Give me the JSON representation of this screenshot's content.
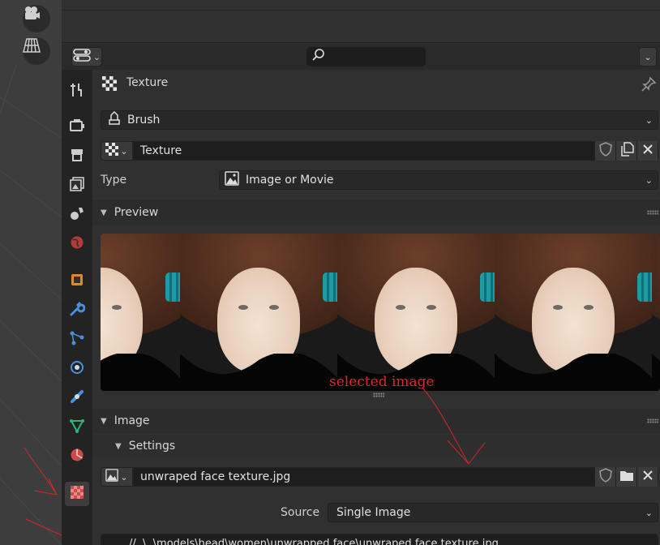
{
  "panel": {
    "title": "Texture",
    "search_placeholder": ""
  },
  "texture_slot": {
    "brush_label": "Brush",
    "texture_name": "Texture",
    "type_label": "Type",
    "type_value": "Image or Movie"
  },
  "preview": {
    "section_title": "Preview"
  },
  "image": {
    "section_title": "Image",
    "settings_title": "Settings",
    "image_name": "unwraped face texture.jpg",
    "source_label": "Source",
    "source_value": "Single Image",
    "filepath": "//..\\..\\models\\head\\women\\unwrapped face\\unwraped face texture.jpg"
  },
  "annotation": {
    "text": "selected image",
    "color": "#e0262a"
  },
  "tabs": [
    "tool-tab",
    "render-tab",
    "output-tab",
    "view-layer-tab",
    "scene-tab",
    "world-tab",
    "object-tab",
    "modifier-tab",
    "particles-tab",
    "physics-tab",
    "constraints-tab",
    "data-tab",
    "material-tab",
    "texture-tab"
  ],
  "colors": {
    "editor_bg": "#303030",
    "field_bg": "#282828",
    "accent_texture": "#c94b4b"
  }
}
